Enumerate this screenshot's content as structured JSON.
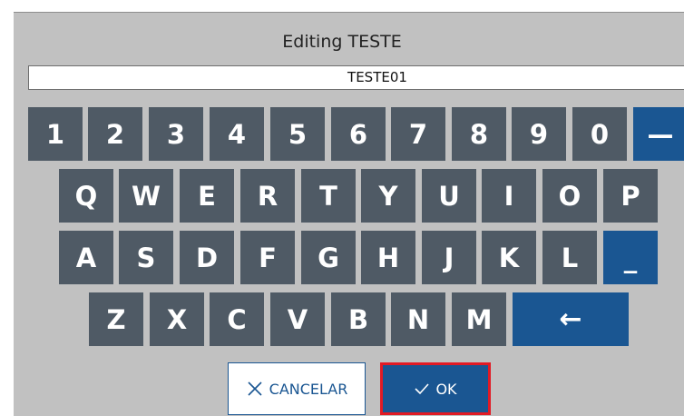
{
  "dialog": {
    "title": "Editing TESTE",
    "value": "TESTE01"
  },
  "keyboard": {
    "row1": [
      "1",
      "2",
      "3",
      "4",
      "5",
      "6",
      "7",
      "8",
      "9",
      "0",
      "—"
    ],
    "row2": [
      "Q",
      "W",
      "E",
      "R",
      "T",
      "Y",
      "U",
      "I",
      "O",
      "P"
    ],
    "row3": [
      "A",
      "S",
      "D",
      "F",
      "G",
      "H",
      "J",
      "K",
      "L",
      "_"
    ],
    "row4": [
      "Z",
      "X",
      "C",
      "V",
      "B",
      "N",
      "M"
    ],
    "backspace": "←"
  },
  "buttons": {
    "cancel_label": "CANCELAR",
    "cancel_icon": "close-icon",
    "ok_label": "OK",
    "ok_icon": "check-icon"
  },
  "colors": {
    "key": "#4f5a65",
    "accent": "#1a5692",
    "focus": "#e21a24",
    "panel": "#c1c1c1"
  }
}
